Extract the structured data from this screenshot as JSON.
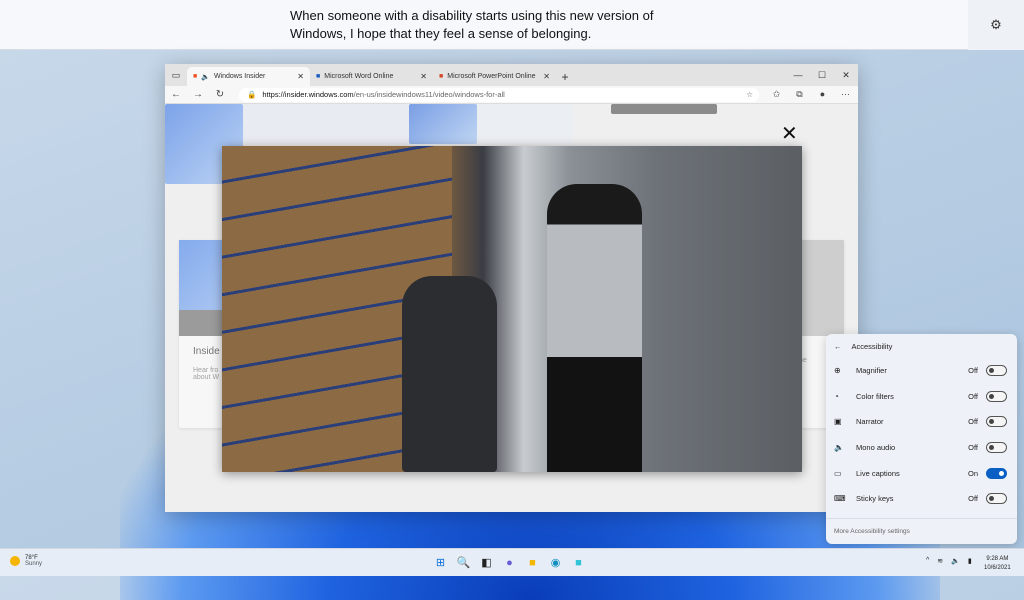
{
  "caption": {
    "text": "When someone with a disability starts using this new version of Windows, I hope that they feel a sense of belonging.",
    "settings_icon": "gear-icon"
  },
  "browser": {
    "tabs": [
      {
        "label": "Windows Insider",
        "active": true,
        "audio": true
      },
      {
        "label": "Microsoft Word Online",
        "active": false
      },
      {
        "label": "Microsoft PowerPoint Online",
        "active": false
      }
    ],
    "url_host": "https://insider.windows.com",
    "url_path": "/en-us/insidewindows11/video/windows-for-all",
    "page_left_title": "Inside",
    "page_left_text1": "Hear fro",
    "page_left_text2": "about W",
    "page_right_title": "y",
    "page_right_text": "the"
  },
  "accessibility": {
    "title": "Accessibility",
    "items": [
      {
        "label": "Magnifier",
        "state": "Off",
        "on": false,
        "icon": "magnifier-icon"
      },
      {
        "label": "Color filters",
        "state": "Off",
        "on": false,
        "icon": "color-filters-icon"
      },
      {
        "label": "Narrator",
        "state": "Off",
        "on": false,
        "icon": "narrator-icon"
      },
      {
        "label": "Mono audio",
        "state": "Off",
        "on": false,
        "icon": "mono-audio-icon"
      },
      {
        "label": "Live captions",
        "state": "On",
        "on": true,
        "icon": "live-captions-icon"
      },
      {
        "label": "Sticky keys",
        "state": "Off",
        "on": false,
        "icon": "sticky-keys-icon"
      }
    ],
    "footer": "More Accessibility settings",
    "accent": "#0a5fc4"
  },
  "taskbar": {
    "temp": "78°F",
    "condition": "Sunny",
    "time": "9:28 AM",
    "date": "10/6/2021"
  }
}
